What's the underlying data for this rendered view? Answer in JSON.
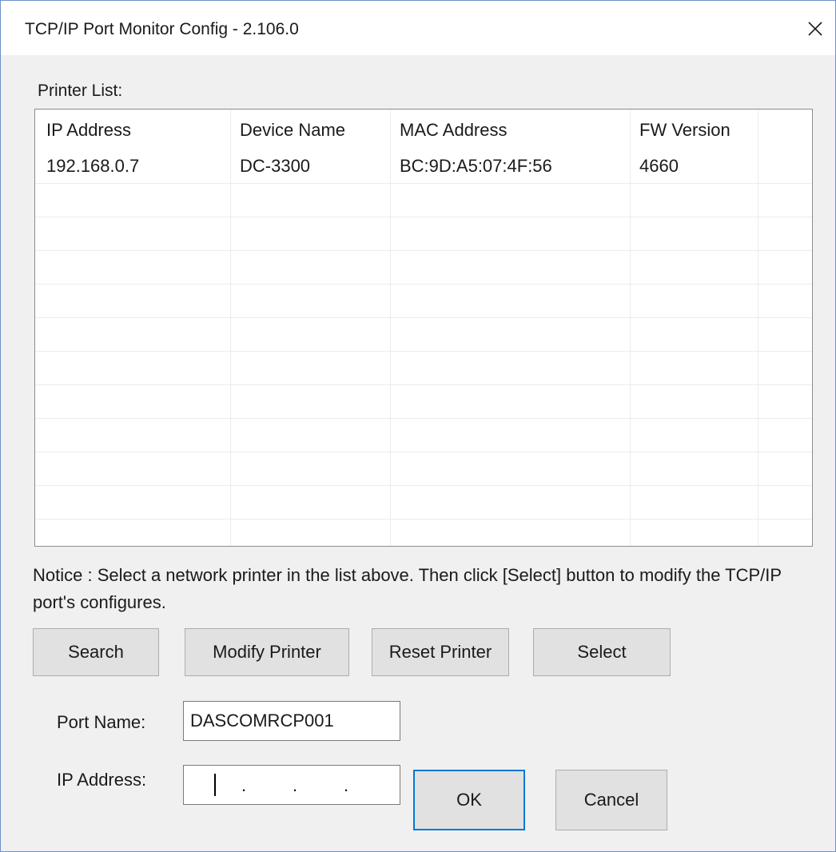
{
  "window": {
    "title": "TCP/IP Port Monitor Config - 2.106.0",
    "close_glyph": "✕"
  },
  "printer_list": {
    "label": "Printer List:",
    "columns": [
      "IP Address",
      "Device Name",
      "MAC Address",
      "FW Version"
    ],
    "rows": [
      [
        "192.168.0.7",
        "DC-3300",
        "BC:9D:A5:07:4F:56",
        "4660"
      ]
    ]
  },
  "notice": "Notice : Select a network printer in the list above. Then click [Select] button to modify the TCP/IP port's configures.",
  "buttons": {
    "search": "Search",
    "modify": "Modify Printer",
    "reset": "Reset Printer",
    "select": "Select",
    "ok": "OK",
    "cancel": "Cancel"
  },
  "port_name": {
    "label": "Port Name:",
    "value": "DASCOMRCP001"
  },
  "ip_address": {
    "label": "IP Address:",
    "separator": "."
  },
  "colors": {
    "accent": "#0078d7",
    "window_border": "#6f8fc9",
    "dialog_bg": "#f0f0f0",
    "button_bg": "#e1e1e1"
  },
  "icons": {
    "close": "close-icon"
  }
}
